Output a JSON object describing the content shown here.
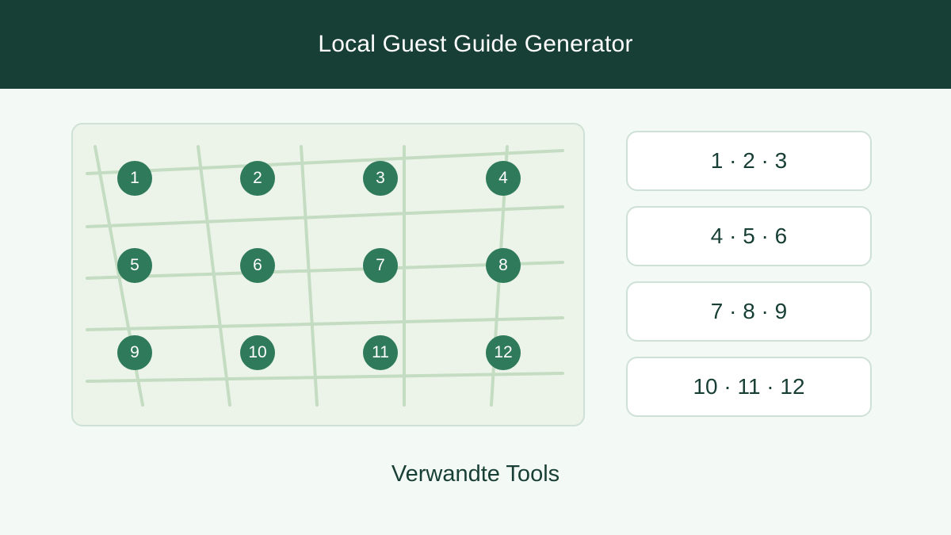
{
  "header": {
    "title": "Local Guest Guide Generator"
  },
  "map": {
    "markers": [
      "1",
      "2",
      "3",
      "4",
      "5",
      "6",
      "7",
      "8",
      "9",
      "10",
      "11",
      "12"
    ]
  },
  "routes": [
    {
      "label": "1 · 2 · 3"
    },
    {
      "label": "4 · 5 · 6"
    },
    {
      "label": "7 · 8 · 9"
    },
    {
      "label": "10 · 11 · 12"
    }
  ],
  "footer": {
    "related_tools_label": "Verwandte Tools"
  },
  "colors": {
    "header_bg": "#183f35",
    "marker": "#2f7a5b",
    "map_bg": "#ecf4ea",
    "road": "#c4dcc2",
    "page_bg": "#f3f9f5"
  }
}
